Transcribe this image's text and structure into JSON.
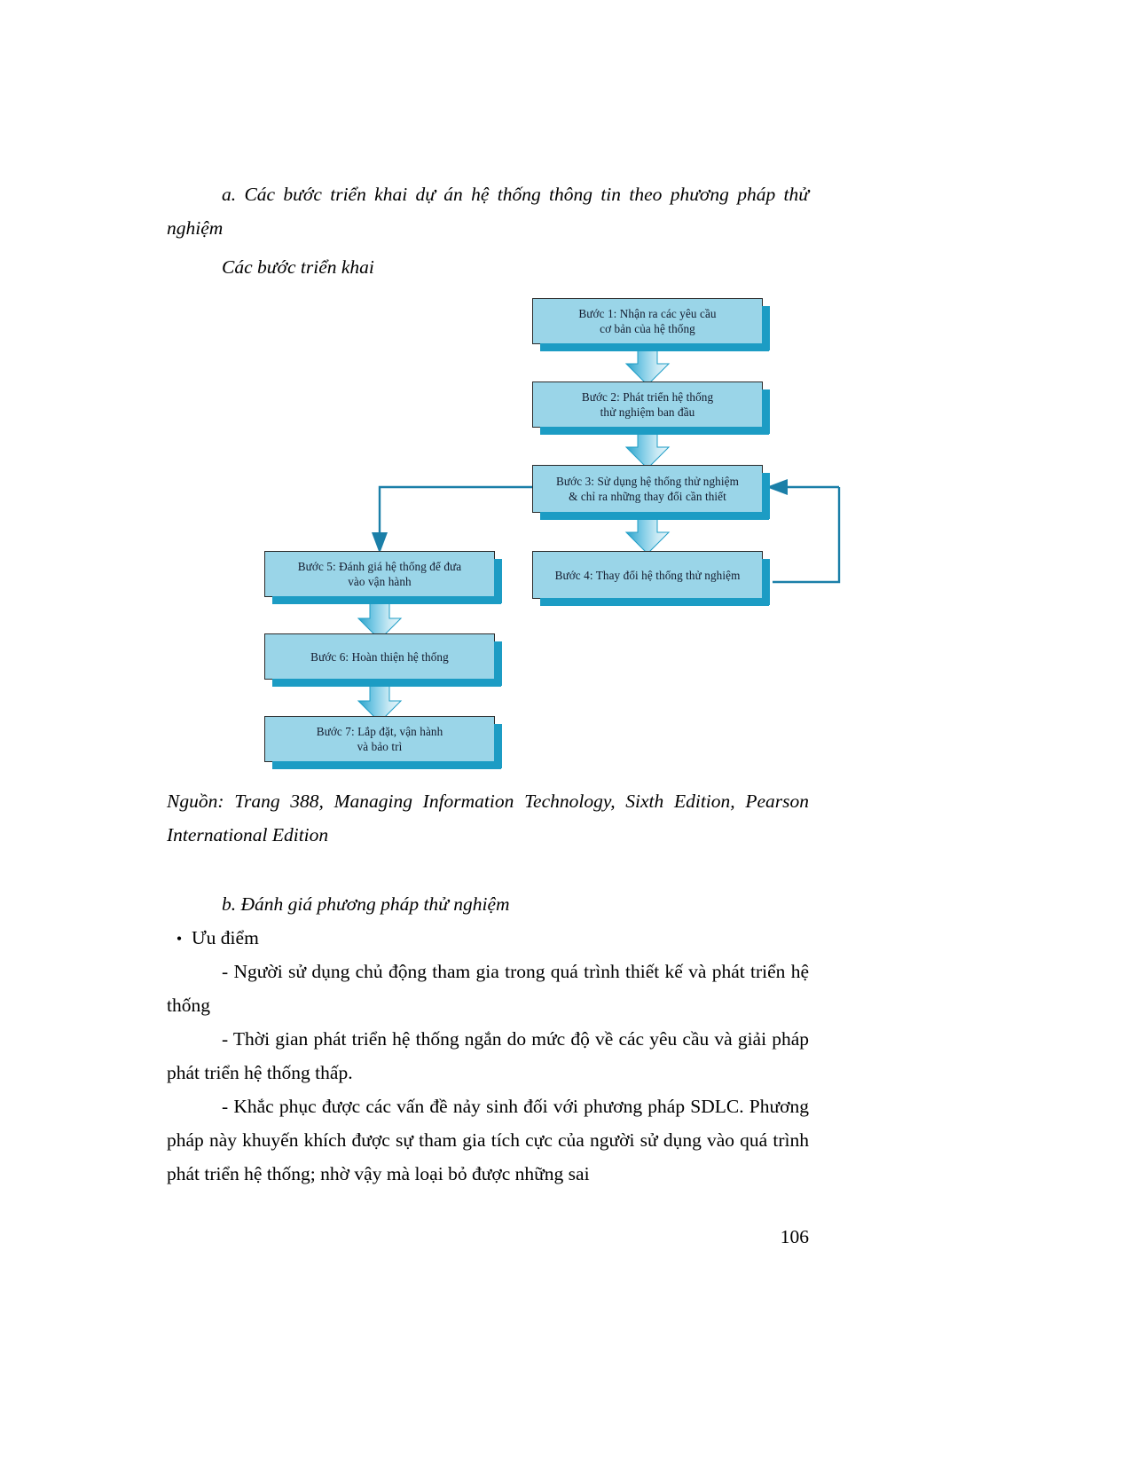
{
  "document": {
    "page_number": "106",
    "heading_a": "a. Các bước triển khai dự án hệ thống thông tin theo phương pháp thử nghiệm",
    "subheading": "Các bước triển khai",
    "source_caption": "Nguồn: Trang 388, Managing Information Technology, Sixth Edition, Pearson International Edition",
    "heading_b": "b. Đánh giá phương pháp thử nghiệm",
    "bullet_label": "Ưu điểm",
    "bullet_marker": "•",
    "paragraphs": [
      "- Người sử dụng chủ động tham gia trong quá trình thiết kế và phát triển hệ thống",
      "- Thời gian phát triển hệ thống ngắn do mức độ về các yêu cầu và giải pháp phát triển hệ thống thấp.",
      "- Khắc phục được các vấn đề nảy sinh đối với phương pháp SDLC. Phương pháp này khuyến khích được sự tham gia tích cực của người sử dụng vào quá trình phát triển hệ thống; nhờ vậy mà loại bỏ được những sai"
    ]
  },
  "figure": {
    "name": "prototyping-method-flowchart",
    "colors": {
      "box_fill": "#9ad5e8",
      "box_border": "#2a2a2a",
      "shadow": "#1c9cc4",
      "arrow_fill": "#a9dcef",
      "arrow_edge": "#1f9dc6",
      "connector_line": "#1b7fa8"
    },
    "nodes": [
      {
        "id": "buoc1",
        "line1": "Bước 1: Nhận ra các yêu cầu",
        "line2": "cơ bản của hệ thống"
      },
      {
        "id": "buoc2",
        "line1": "Bước 2: Phát triển hệ thống",
        "line2": "thử nghiệm ban đầu"
      },
      {
        "id": "buoc3",
        "line1": "Bước 3: Sử dụng hệ thống thử  nghiệm",
        "line2": "& chỉ ra những thay đổi cần thiết"
      },
      {
        "id": "buoc4",
        "line1": "Bước 4: Thay đổi hệ thống thử nghiệm",
        "line2": ""
      },
      {
        "id": "buoc5",
        "line1": "Bước 5: Đánh giá hệ thống để đưa",
        "line2": "vào vận hành"
      },
      {
        "id": "buoc6",
        "line1": "Bước 6: Hoàn thiện hệ thống",
        "line2": ""
      },
      {
        "id": "buoc7",
        "line1": "Bước 7: Lắp đặt, vận hành",
        "line2": "và bảo trì"
      }
    ],
    "edges": [
      {
        "from": "buoc1",
        "to": "buoc2",
        "type": "block-arrow-down"
      },
      {
        "from": "buoc2",
        "to": "buoc3",
        "type": "block-arrow-down"
      },
      {
        "from": "buoc3",
        "to": "buoc4",
        "type": "block-arrow-down"
      },
      {
        "from": "buoc4",
        "to": "buoc3",
        "type": "feedback-loop-right"
      },
      {
        "from": "buoc3",
        "to": "buoc5",
        "type": "branch-left-down"
      },
      {
        "from": "buoc5",
        "to": "buoc6",
        "type": "block-arrow-down"
      },
      {
        "from": "buoc6",
        "to": "buoc7",
        "type": "block-arrow-down"
      }
    ]
  }
}
